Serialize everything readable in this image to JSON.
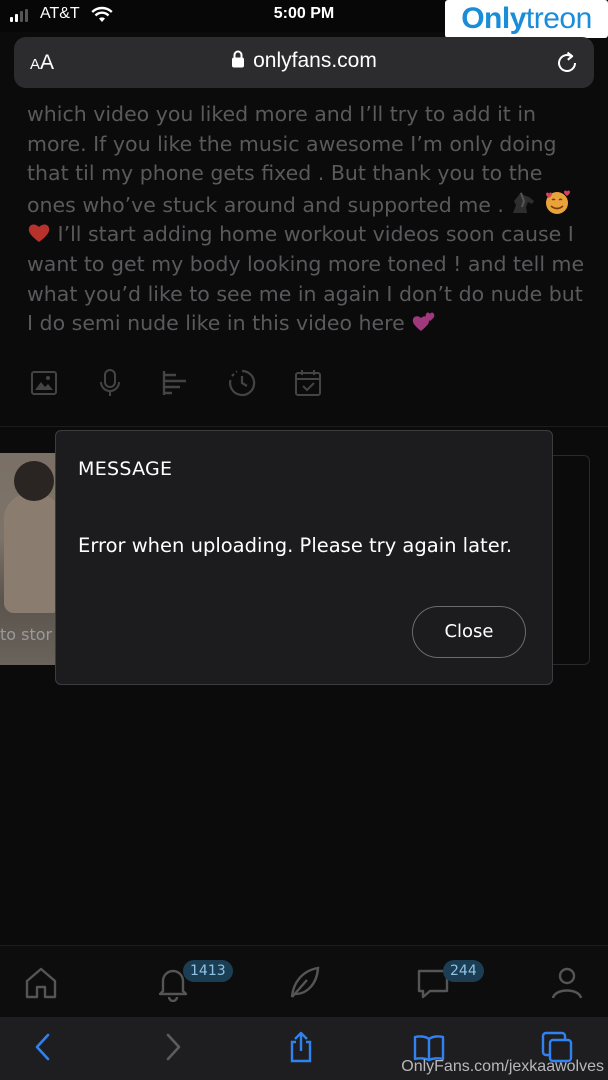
{
  "status_bar": {
    "carrier": "AT&T",
    "time": "5:00 PM"
  },
  "watermark_logo": {
    "part1": "Only",
    "part2": "treon"
  },
  "browser": {
    "text_size_small": "A",
    "text_size_large": "A",
    "url": "onlyfans.com"
  },
  "post": {
    "text": "which video you liked more and I’ll try to add it in more. If you like the music awesome I’m only doing that til my phone gets fixed . But thank you to the ones who’ve stuck around and supported me .",
    "text_after_emoji": "I’ll start adding home workout videos soon cause I want to get my body looking more toned ! and tell me what you’d like to see me in again I don’t do nude but I do semi nude like in this video here",
    "emojis": [
      "horse-emoji",
      "smiling-face-with-hearts-emoji",
      "red-heart-emoji",
      "two-hearts-emoji"
    ]
  },
  "composer_icons": [
    "image-icon",
    "microphone-icon",
    "poll-icon",
    "timer-icon",
    "calendar-check-icon"
  ],
  "story": {
    "label": "to stor"
  },
  "modal": {
    "title": "MESSAGE",
    "message": "Error when uploading. Please try again later.",
    "close_label": "Close"
  },
  "app_nav": {
    "items": [
      "home-icon",
      "notifications-icon",
      "new-post-icon",
      "messages-icon",
      "profile-icon"
    ],
    "notifications_badge": "1413",
    "messages_badge": "244"
  },
  "safari_toolbar": {
    "source_url": "OnlyFans.com/jexkaawolves"
  },
  "colors": {
    "accent": "#1a8cd8",
    "background": "#0b0b0c",
    "modal_bg": "#1c1c1e",
    "badge_bg": "#1b3e55",
    "muted_text": "#5a5a5c"
  }
}
